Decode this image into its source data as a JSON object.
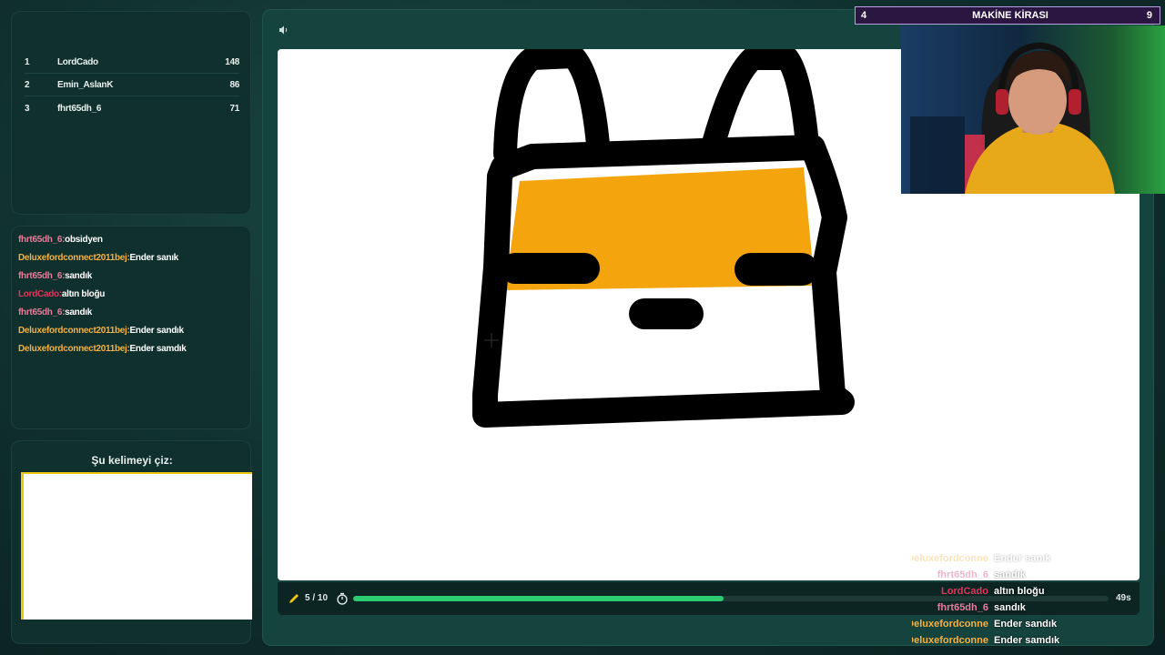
{
  "leaderboard": [
    {
      "rank": "1",
      "name": "LordCado",
      "score": "148"
    },
    {
      "rank": "2",
      "name": "Emin_AslanK",
      "score": "86"
    },
    {
      "rank": "3",
      "name": "fhrt65dh_6",
      "score": "71"
    }
  ],
  "chat": [
    {
      "user": "fhrt65dh_6",
      "sep": ":",
      "msg": "obsidyen",
      "color": "#e87a9a"
    },
    {
      "user": "Deluxefordconnect2011bej",
      "sep": ":",
      "msg": "Ender sanık",
      "color": "#f5b041"
    },
    {
      "user": "fhrt65dh_6",
      "sep": ":",
      "msg": "sandık",
      "color": "#e87a9a"
    },
    {
      "user": "LordCado",
      "sep": ":",
      "msg": "altın bloğu",
      "color": "#e0355c"
    },
    {
      "user": "fhrt65dh_6",
      "sep": ":",
      "msg": "sandık",
      "color": "#e87a9a"
    },
    {
      "user": "Deluxefordconnect2011bej",
      "sep": ":",
      "msg": "Ender sandık",
      "color": "#f5b041"
    },
    {
      "user": "Deluxefordconnect2011bej",
      "sep": ":",
      "msg": "Ender samdık",
      "color": "#f5b041"
    }
  ],
  "word_panel": {
    "title": "Şu kelimeyi çiz:",
    "word": ""
  },
  "game": {
    "round": "5 / 10",
    "time_left": "49s",
    "progress": 0.49
  },
  "overlay_chat": [
    {
      "user": "Deluxefordconne...",
      "msg": "Ender sanık",
      "color": "#f5b041",
      "faded": true
    },
    {
      "user": "fhrt65dh_6",
      "msg": "sandık",
      "color": "#e87a9a",
      "faded": true
    },
    {
      "user": "LordCado",
      "msg": "altın bloğu",
      "color": "#e0355c",
      "faded": false
    },
    {
      "user": "fhrt65dh_6",
      "msg": "sandık",
      "color": "#e87a9a",
      "faded": false
    },
    {
      "user": "Deluxefordconne...",
      "msg": "Ender sandık",
      "color": "#f5b041",
      "faded": false
    },
    {
      "user": "Deluxefordconne...",
      "msg": "Ender samdık",
      "color": "#f5b041",
      "faded": false
    }
  ],
  "banner": {
    "left": "4",
    "title": "MAKİNE KİRASI",
    "right": "9"
  },
  "icons": {
    "sound": "speaker-icon",
    "pencil": "pencil-icon",
    "timer": "stopwatch-icon",
    "cursor": "crosshair-icon"
  }
}
